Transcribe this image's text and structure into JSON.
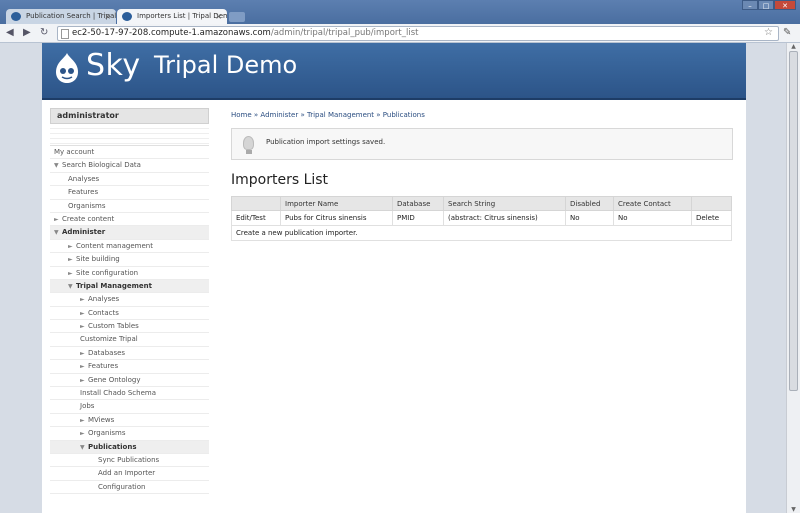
{
  "browser": {
    "tabs": [
      {
        "label": "Publication Search | Tripal"
      },
      {
        "label": "Importers List | Tripal Demo"
      }
    ],
    "address": {
      "host": "ec2-50-17-97-208.compute-1.amazonaws.com",
      "path": "/admin/tripal/tripal_pub/import_list"
    }
  },
  "site": {
    "brand": "Sky",
    "name": "Tripal Demo"
  },
  "sidebar": {
    "title": "administrator",
    "items": [
      {
        "label": "My account"
      },
      {
        "label": "Search Biological Data"
      },
      {
        "label": "Analyses"
      },
      {
        "label": "Features"
      },
      {
        "label": "Organisms"
      },
      {
        "label": "Create content"
      },
      {
        "label": "Administer"
      },
      {
        "label": "Content management"
      },
      {
        "label": "Site building"
      },
      {
        "label": "Site configuration"
      },
      {
        "label": "Tripal Management"
      },
      {
        "label": "Analyses"
      },
      {
        "label": "Contacts"
      },
      {
        "label": "Custom Tables"
      },
      {
        "label": "Customize Tripal"
      },
      {
        "label": "Databases"
      },
      {
        "label": "Features"
      },
      {
        "label": "Gene Ontology"
      },
      {
        "label": "Install Chado Schema"
      },
      {
        "label": "Jobs"
      },
      {
        "label": "MViews"
      },
      {
        "label": "Organisms"
      },
      {
        "label": "Publications"
      },
      {
        "label": "Sync Publications"
      },
      {
        "label": "Add an Importer"
      },
      {
        "label": "Configuration"
      }
    ]
  },
  "main": {
    "breadcrumb": "Home » Administer » Tripal Management » Publications",
    "status_message": "Publication import settings saved.",
    "title": "Importers List",
    "table": {
      "headers": [
        "",
        "Importer Name",
        "Database",
        "Search String",
        "Disabled",
        "Create Contact",
        ""
      ],
      "rows": [
        {
          "edit": "Edit/Test",
          "name": "Pubs for Citrus sinensis",
          "database": "PMID",
          "search": "(abstract: Citrus sinensis)",
          "disabled": "No",
          "contact": "No",
          "delete": "Delete"
        }
      ],
      "create_link": "Create a new publication importer."
    }
  },
  "colors": {
    "header": "#2c5488",
    "link": "#2a4d80"
  }
}
